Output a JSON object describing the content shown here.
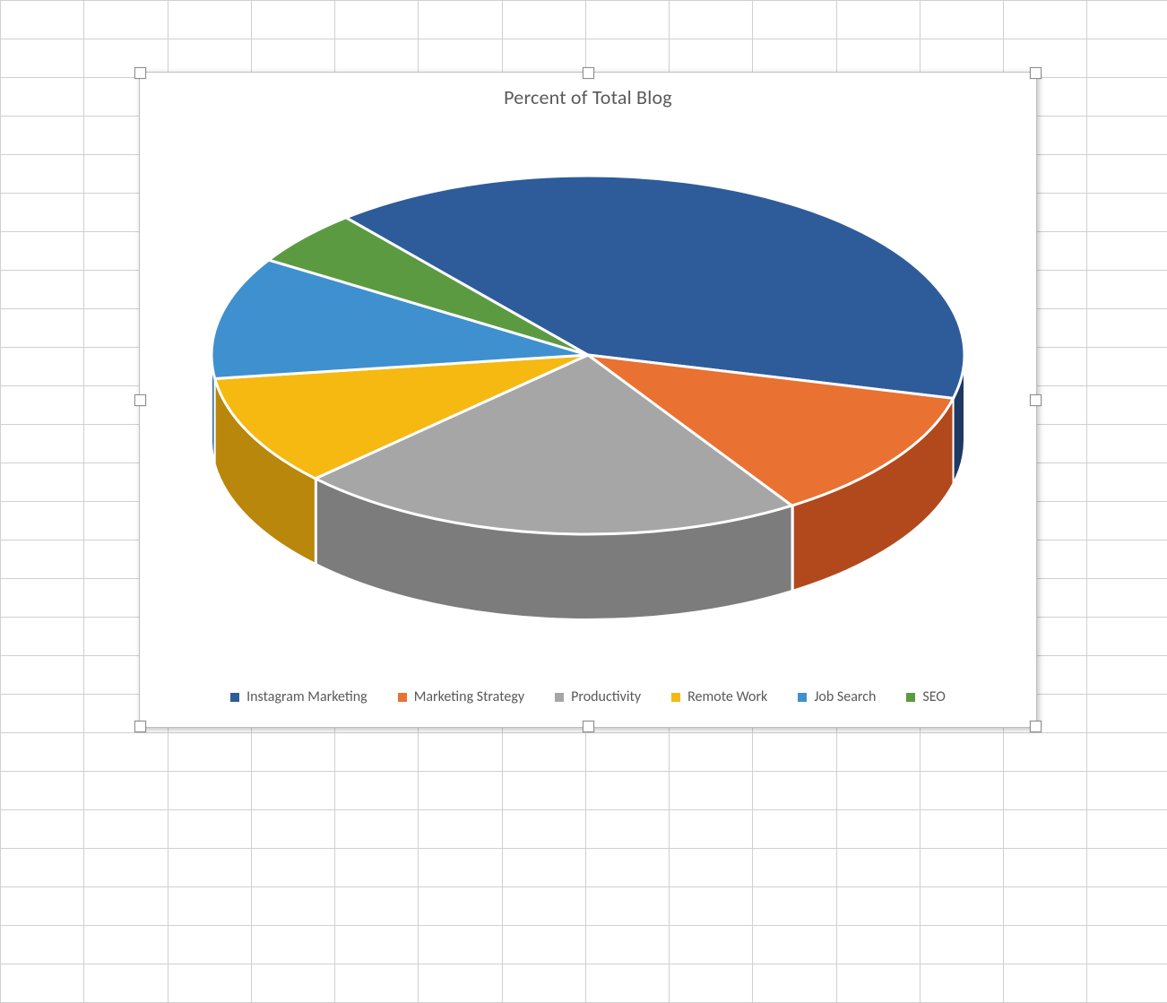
{
  "chart_data": {
    "type": "pie",
    "title": "Percent of Total Blog",
    "series": [
      {
        "name": "Instagram Marketing",
        "value": 40,
        "color": "#2E5C9A",
        "dark": "#1C3A63"
      },
      {
        "name": "Marketing Strategy",
        "value": 12,
        "color": "#E97132",
        "dark": "#B2491C"
      },
      {
        "name": "Productivity",
        "value": 22,
        "color": "#A6A6A6",
        "dark": "#7C7C7C"
      },
      {
        "name": "Remote Work",
        "value": 10,
        "color": "#F5B912",
        "dark": "#B8870B"
      },
      {
        "name": "Job Search",
        "value": 11,
        "color": "#3F90CF",
        "dark": "#2C6A9B"
      },
      {
        "name": "SEO",
        "value": 5,
        "color": "#5C9A42",
        "dark": "#3C6A29"
      }
    ],
    "legend_position": "bottom",
    "style_3d": true
  }
}
